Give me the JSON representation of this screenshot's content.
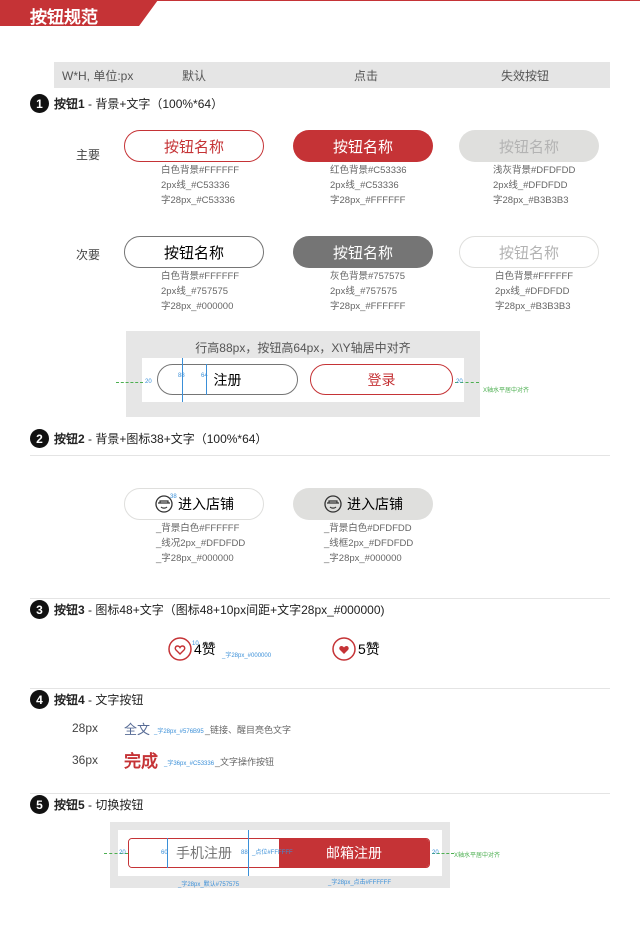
{
  "page_title": "按钮规范",
  "header": {
    "size": "W*H, 单位:px",
    "default": "默认",
    "click": "点击",
    "disabled": "失效按钮"
  },
  "s1": {
    "num": "1",
    "title": "按钮1",
    "subtitle": " - 背景+文字（100%*64）",
    "primary_label": "主要",
    "secondary_label": "次要",
    "btn_text": "按钮名称",
    "primary": [
      [
        "白色背景#FFFFFF",
        "2px线_#C53336",
        "字28px_#C53336"
      ],
      [
        "红色背景#C53336",
        "2px线_#C53336",
        "字28px_#FFFFFF"
      ],
      [
        "浅灰背景#DFDFDD",
        "2px线_#DFDFDD",
        "字28px_#B3B3B3"
      ]
    ],
    "secondary": [
      [
        "白色背景#FFFFFF",
        "2px线_#757575",
        "字28px_#000000"
      ],
      [
        "灰色背景#757575",
        "2px线_#757575",
        "字28px_#FFFFFF"
      ],
      [
        "白色背景#FFFFFF",
        "2px线_#DFDFDD",
        "字28px_#B3B3B3"
      ]
    ],
    "demo_caption": "行高88px，按钮高64px，X\\Y轴居中对齐",
    "register": "注册",
    "login": "登录",
    "m20": "20",
    "m88": "88",
    "m64": "64",
    "axis_note": "X轴水平居中对齐"
  },
  "s2": {
    "num": "2",
    "title": "按钮2",
    "subtitle": " - 背景+图标38+文字（100%*64）",
    "btn_text": "进入店铺",
    "icon_size": "38",
    "specs": [
      [
        "_背景白色#FFFFFF",
        "_线况2px_#DFDFDD",
        "_字28px_#000000"
      ],
      [
        "_背景白色#DFDFDD",
        "_线框2px_#DFDFDD",
        "_字28px_#000000"
      ]
    ]
  },
  "s3": {
    "num": "3",
    "title": "按钮3",
    "subtitle": " - 图标48+文字（图标48+10px间距+文字28px_#000000)",
    "like1": "4赞",
    "like2": "5赞",
    "gap": "10",
    "note": "_字28px_#000000"
  },
  "s4": {
    "num": "4",
    "title": "按钮4",
    "subtitle": " - 文字按钮",
    "r1_size": "28px",
    "r1_text": "全文",
    "r1_note": "_字28px_#576B95",
    "r1_desc": "_链接、醒目亮色文字",
    "r2_size": "36px",
    "r2_text": "完成",
    "r2_note": "_字36px_#C53336",
    "r2_desc": "_文字操作按钮"
  },
  "s5": {
    "num": "5",
    "title": "按钮5",
    "subtitle": " - 切换按钮",
    "phone": "手机注册",
    "email": "邮箱注册",
    "m20": "20",
    "m60": "60",
    "m88": "88",
    "mid_note": "_点位#FFFFFF",
    "note_left": "_字28px_默认#757575",
    "note_right": "_字28px_点击#FFFFFF",
    "axis_note": "X轴水平居中对齐"
  }
}
